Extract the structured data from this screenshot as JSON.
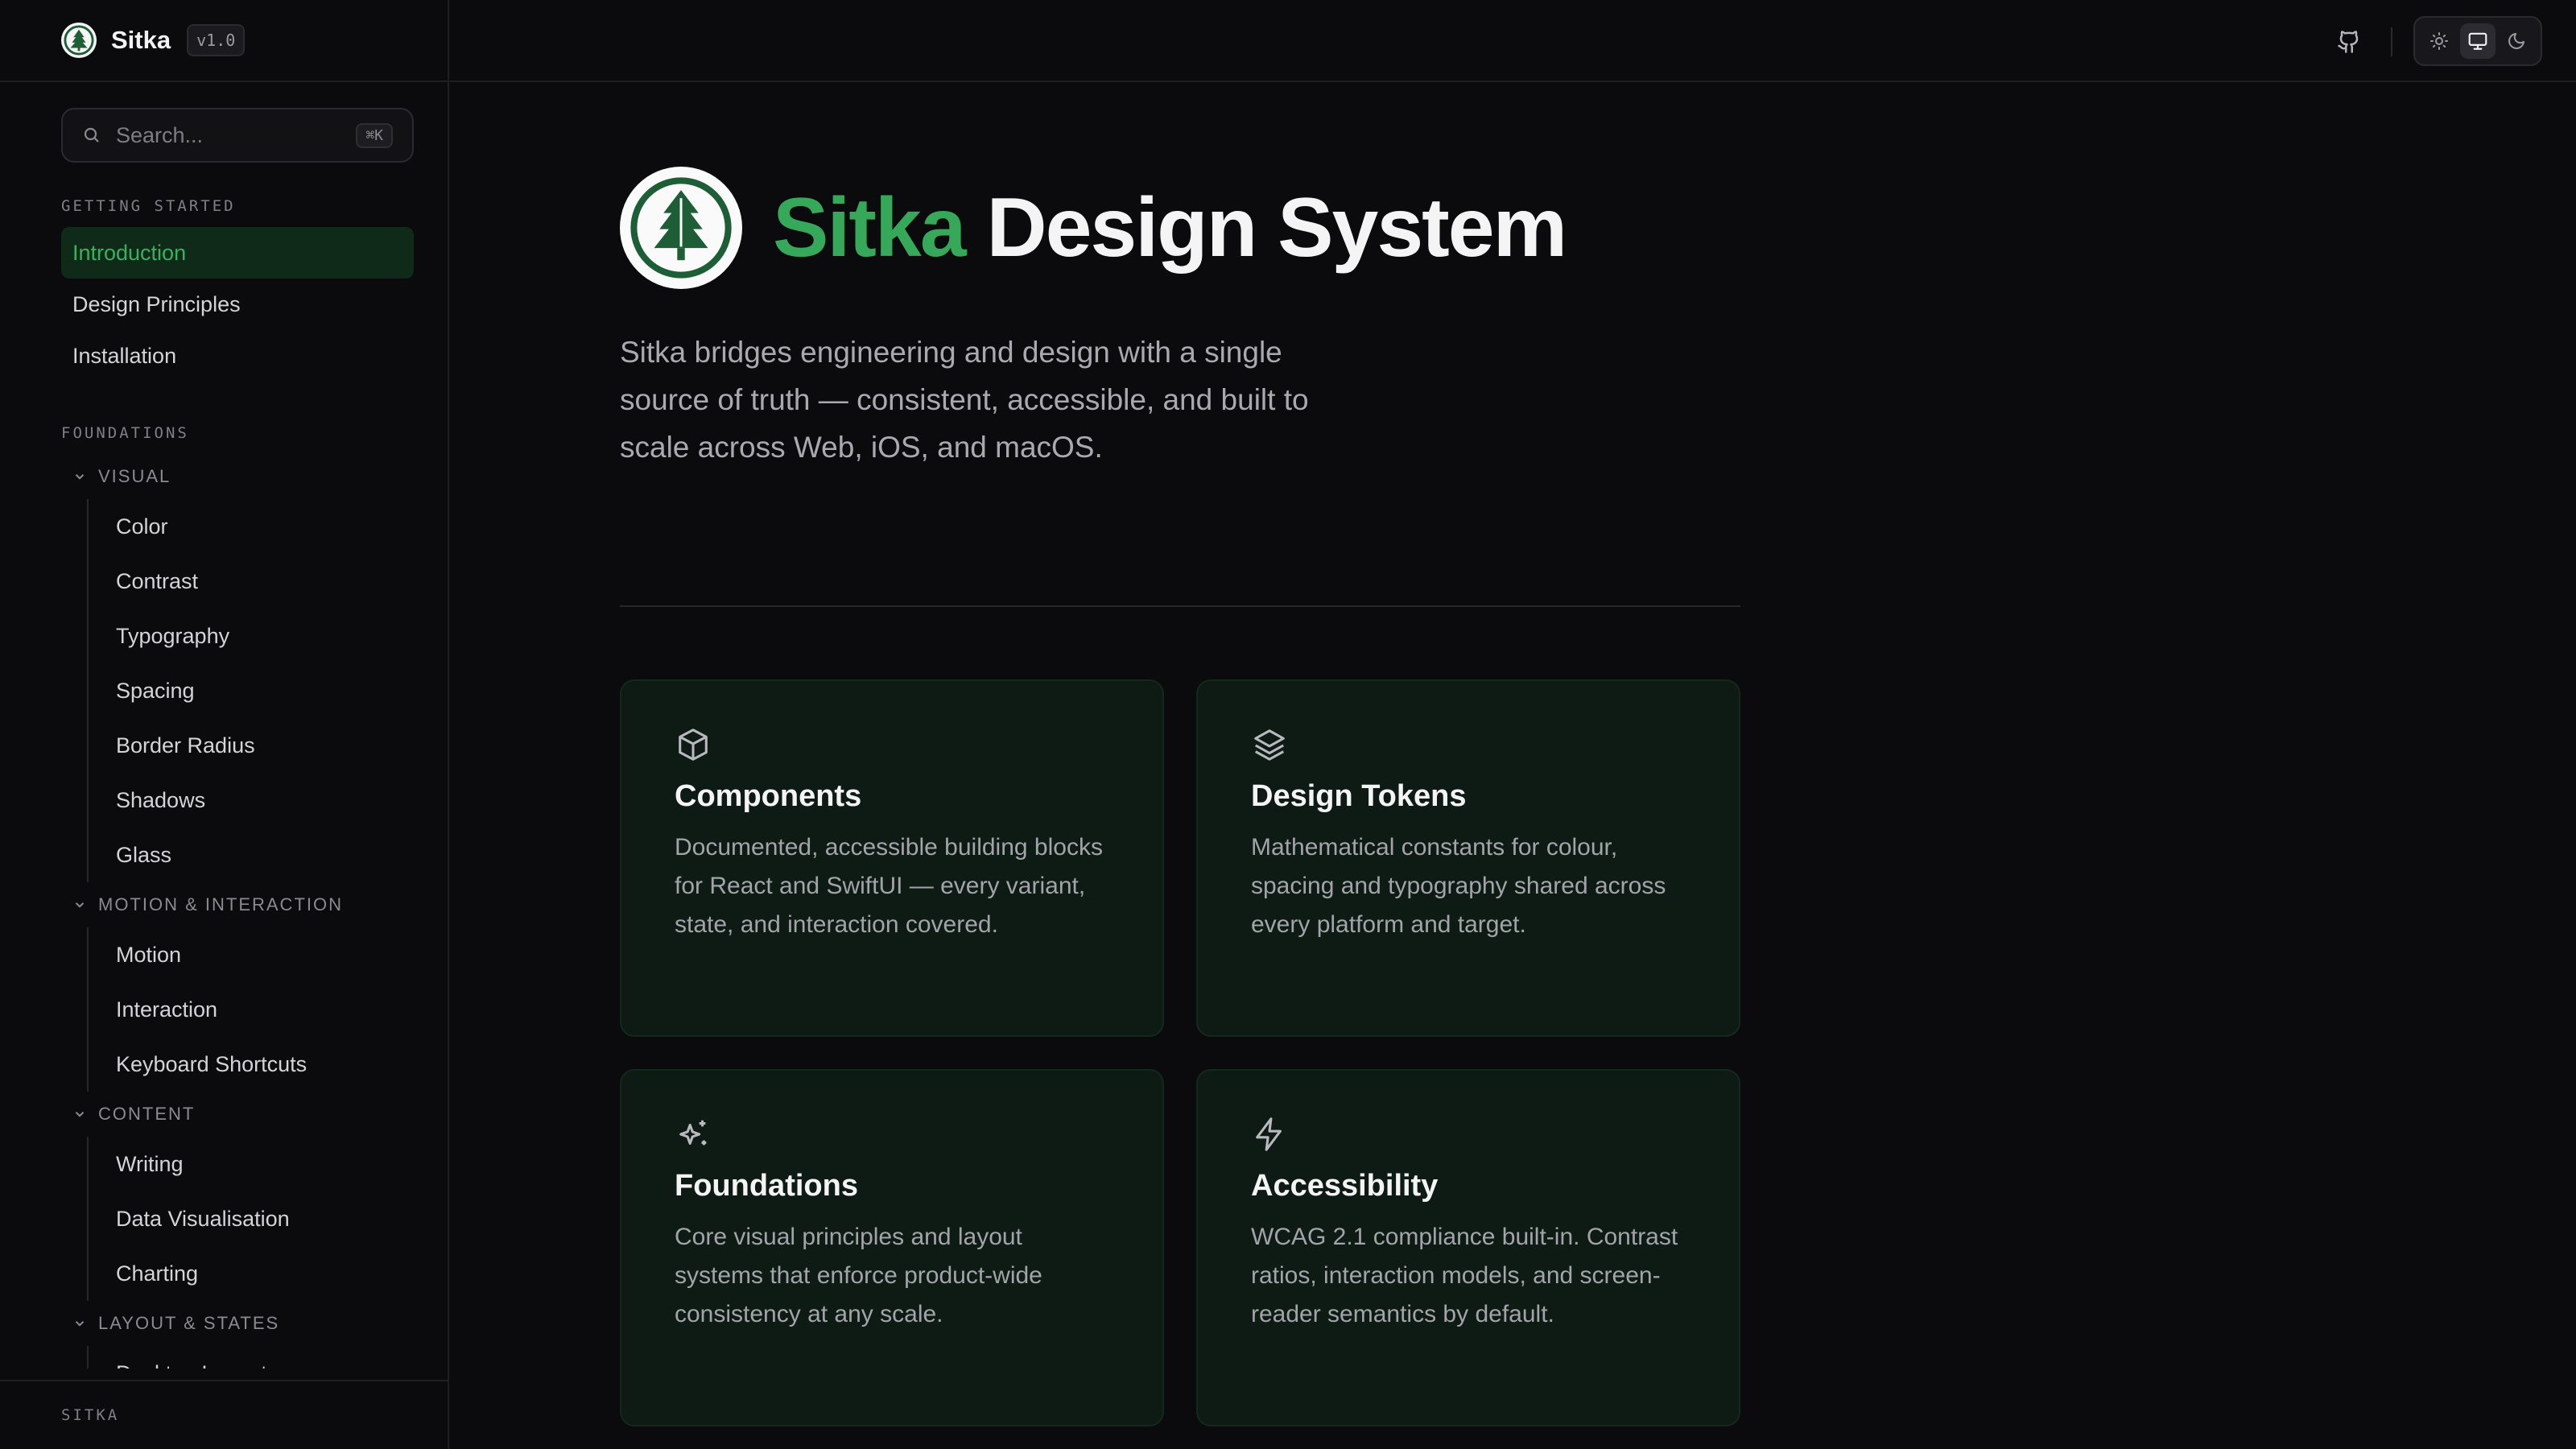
{
  "app": {
    "brand": "Sitka",
    "version": "v1.0"
  },
  "search": {
    "placeholder": "Search...",
    "shortcut": "⌘K"
  },
  "sidebar": {
    "sections": [
      {
        "title": "GETTING STARTED",
        "items": [
          {
            "label": "Introduction",
            "active": true
          },
          {
            "label": "Design Principles"
          },
          {
            "label": "Installation"
          }
        ]
      },
      {
        "title": "FOUNDATIONS",
        "groups": [
          {
            "title": "VISUAL",
            "items": [
              "Color",
              "Contrast",
              "Typography",
              "Spacing",
              "Border Radius",
              "Shadows",
              "Glass"
            ]
          },
          {
            "title": "MOTION & INTERACTION",
            "items": [
              "Motion",
              "Interaction",
              "Keyboard Shortcuts"
            ]
          },
          {
            "title": "CONTENT",
            "items": [
              "Writing",
              "Data Visualisation",
              "Charting"
            ]
          },
          {
            "title": "LAYOUT & STATES",
            "items": [
              "Desktop Layout"
            ]
          }
        ]
      }
    ],
    "footer": "SITKA"
  },
  "topbar": {
    "icons": [
      "github-icon",
      "sun-icon",
      "monitor-icon",
      "moon-icon"
    ],
    "theme_selected": "system"
  },
  "hero": {
    "title_accent": "Sitka",
    "title_rest": "Design System",
    "lead": "Sitka bridges engineering and design with a single source of truth — consistent, accessible, and built to scale across Web, iOS, and macOS."
  },
  "cards": [
    {
      "icon": "box-icon",
      "title": "Components",
      "desc": "Documented, accessible building blocks for React and SwiftUI — every variant, state, and interaction covered."
    },
    {
      "icon": "layers-icon",
      "title": "Design Tokens",
      "desc": "Mathematical constants for colour, spacing and typography shared across every platform and target."
    },
    {
      "icon": "sparkles-icon",
      "title": "Foundations",
      "desc": "Core visual principles and layout systems that enforce product-wide consistency at any scale."
    },
    {
      "icon": "zap-icon",
      "title": "Accessibility",
      "desc": "WCAG 2.1 compliance built-in. Contrast ratios, interaction models, and screen-reader semantics by default."
    }
  ],
  "colors": {
    "accent": "#35a85a",
    "background": "#0b0b0d",
    "card_background": "#0e1b14",
    "active_nav_bg": "#0f2a18"
  }
}
